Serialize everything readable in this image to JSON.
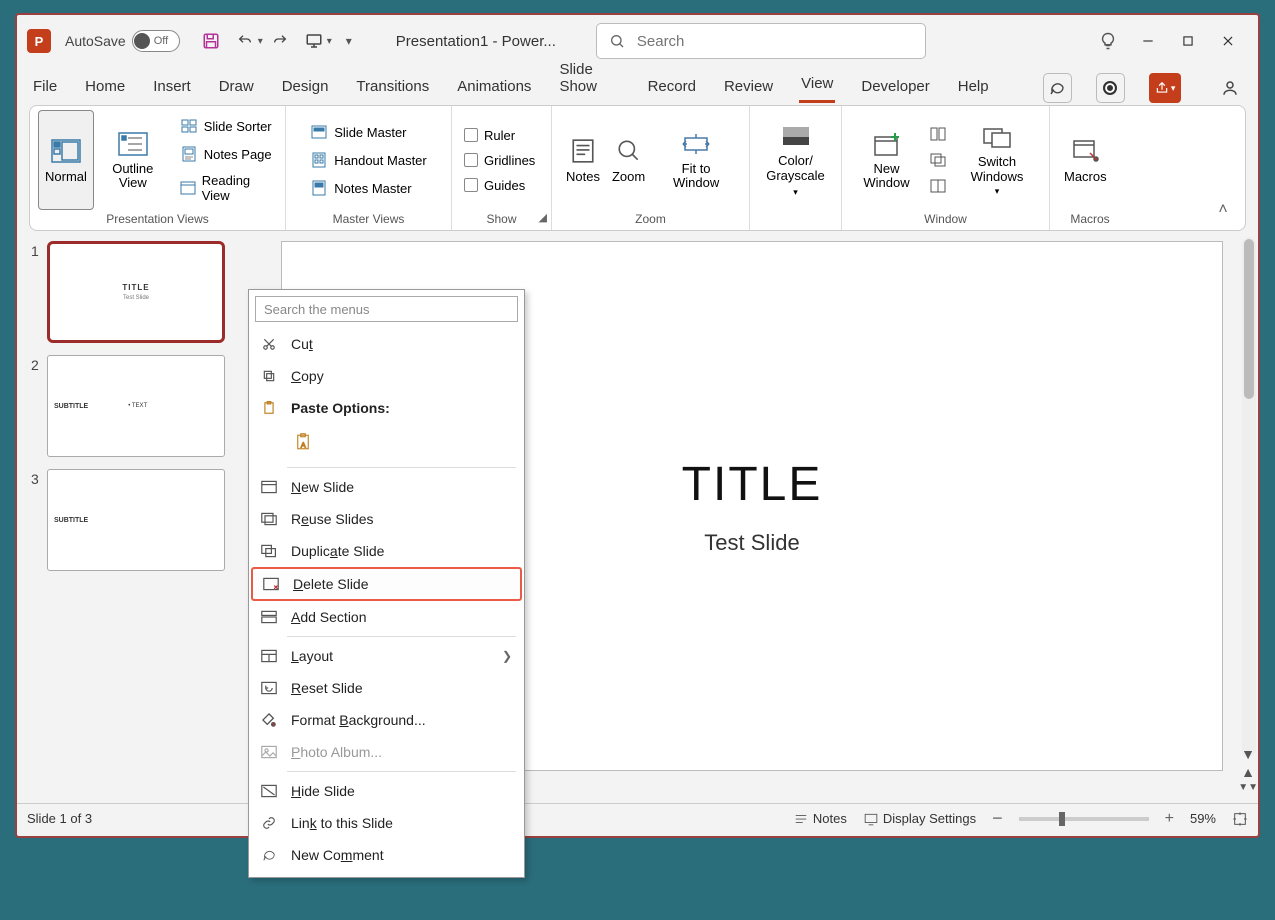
{
  "title_bar": {
    "autosave_label": "AutoSave",
    "autosave_state": "Off",
    "document_title": "Presentation1 - Power...",
    "search_placeholder": "Search"
  },
  "tabs": [
    "File",
    "Home",
    "Insert",
    "Draw",
    "Design",
    "Transitions",
    "Animations",
    "Slide Show",
    "Record",
    "Review",
    "View",
    "Developer",
    "Help"
  ],
  "active_tab": "View",
  "ribbon": {
    "presentation_views": {
      "label": "Presentation Views",
      "normal": "Normal",
      "outline": "Outline View",
      "slide_sorter": "Slide Sorter",
      "notes_page": "Notes Page",
      "reading_view": "Reading View"
    },
    "master_views": {
      "label": "Master Views",
      "slide_master": "Slide Master",
      "handout_master": "Handout Master",
      "notes_master": "Notes Master"
    },
    "show": {
      "label": "Show",
      "ruler": "Ruler",
      "gridlines": "Gridlines",
      "guides": "Guides"
    },
    "zoom_group": {
      "label": "Zoom",
      "notes": "Notes",
      "zoom": "Zoom",
      "fit": "Fit to Window"
    },
    "color_group": {
      "label": "",
      "color": "Color/ Grayscale"
    },
    "window_group": {
      "label": "Window",
      "new_window": "New Window",
      "switch": "Switch Windows"
    },
    "macros_group": {
      "label": "Macros",
      "macros": "Macros"
    }
  },
  "thumbnails": [
    {
      "num": "1",
      "title": "TITLE",
      "sub": "Test Slide",
      "layout": "center",
      "selected": true
    },
    {
      "num": "2",
      "title": "SUBTITLE",
      "sub": "• TEXT",
      "layout": "left",
      "selected": false
    },
    {
      "num": "3",
      "title": "SUBTITLE",
      "sub": "",
      "layout": "left",
      "selected": false
    }
  ],
  "slide": {
    "title": "TITLE",
    "subtitle": "Test Slide"
  },
  "status": {
    "slide_info": "Slide 1 of 3",
    "notes": "Notes",
    "display": "Display Settings",
    "zoom": "59%"
  },
  "context_menu": {
    "search_placeholder": "Search the menus",
    "items": {
      "cut": "Cut",
      "copy": "Copy",
      "paste_header": "Paste Options:",
      "new_slide": "New Slide",
      "reuse": "Reuse Slides",
      "duplicate": "Duplicate Slide",
      "delete": "Delete Slide",
      "add_section": "Add Section",
      "layout": "Layout",
      "reset": "Reset Slide",
      "format_bg": "Format Background...",
      "photo_album": "Photo Album...",
      "hide": "Hide Slide",
      "link": "Link to this Slide",
      "new_comment": "New Comment"
    }
  }
}
